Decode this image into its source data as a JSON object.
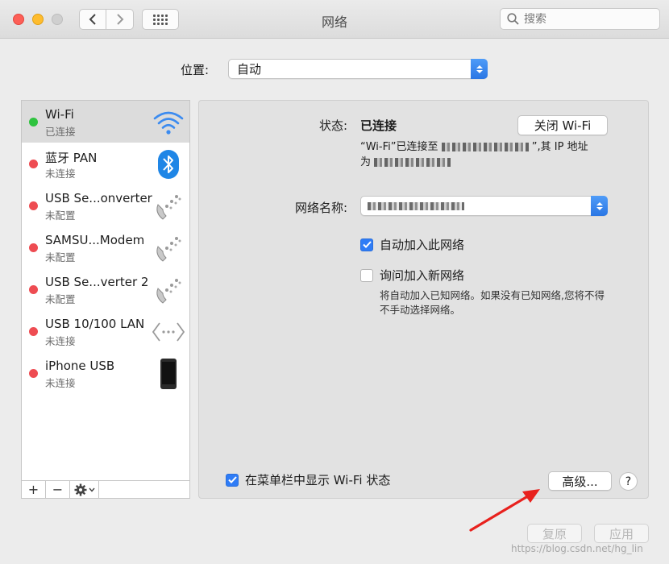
{
  "window": {
    "title": "网络"
  },
  "search": {
    "placeholder": "搜索"
  },
  "location": {
    "label": "位置:",
    "value": "自动"
  },
  "services": [
    {
      "name": "Wi-Fi",
      "status": "已连接",
      "dot": "green",
      "icon": "wifi-icon"
    },
    {
      "name": "蓝牙 PAN",
      "status": "未连接",
      "dot": "red",
      "icon": "bluetooth-icon"
    },
    {
      "name": "USB Se...onverter",
      "status": "未配置",
      "dot": "red",
      "icon": "phone-icon"
    },
    {
      "name": "SAMSU...Modem",
      "status": "未配置",
      "dot": "red",
      "icon": "phone-icon"
    },
    {
      "name": "USB Se...verter 2",
      "status": "未配置",
      "dot": "red",
      "icon": "phone-icon"
    },
    {
      "name": "USB 10/100 LAN",
      "status": "未连接",
      "dot": "red",
      "icon": "ethernet-icon"
    },
    {
      "name": "iPhone USB",
      "status": "未连接",
      "dot": "red",
      "icon": "iphone-icon"
    }
  ],
  "sidebar_footer": {
    "add": "+",
    "remove": "−"
  },
  "detail": {
    "status_label": "状态:",
    "status_value": "已连接",
    "turn_off_button": "关闭 Wi-Fi",
    "desc_prefix": "“Wi-Fi”已连接至",
    "desc_middle": "”,其 IP 地址",
    "desc_line2_prefix": "为",
    "network_name_label": "网络名称:",
    "auto_join_label": "自动加入此网络",
    "ask_join_label": "询问加入新网络",
    "hint": "将自动加入已知网络。如果没有已知网络,您将不得不手动选择网络。",
    "show_menu_label": "在菜单栏中显示 Wi-Fi 状态",
    "advanced_button": "高级...",
    "help_button": "?"
  },
  "buttons": {
    "revert": "复原",
    "apply": "应用"
  },
  "watermark": "https://blog.csdn.net/hg_lin",
  "colors": {
    "accent": "#2f7cf6",
    "connected": "#2fc33f",
    "disconnected": "#ee4c52",
    "annotation_arrow": "#e8211d"
  }
}
